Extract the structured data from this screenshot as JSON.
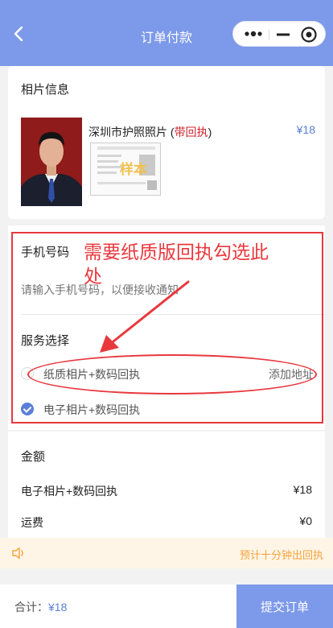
{
  "header": {
    "title": "订单付款",
    "back_icon": "chevron-left-icon",
    "capsule_icons": [
      "more-dots-icon",
      "minimize-icon",
      "close-circle-icon"
    ]
  },
  "photo_info": {
    "title": "相片信息",
    "product_name": "深圳市护照照片 (",
    "product_tag": "带回执",
    "product_tag_close": ")",
    "price": "¥18",
    "thumb_stamp": "样本"
  },
  "form": {
    "phone_label": "手机号码",
    "phone_placeholder": "请输入手机号码，以便接收通知",
    "service_label": "服务选择",
    "options": [
      {
        "label": "纸质相片+数码回执",
        "action": "添加地址",
        "checked": false
      },
      {
        "label": "电子相片+数码回执",
        "action": "",
        "checked": true
      }
    ]
  },
  "annotation": {
    "text": "需要纸质版回执勾选此处"
  },
  "amount": {
    "title": "金额",
    "rows": [
      {
        "label": "电子相片+数码回执",
        "value": "¥18"
      },
      {
        "label": "运费",
        "value": "¥0"
      }
    ]
  },
  "notice": {
    "text": "预计十分钟出回执",
    "icon": "speaker-icon"
  },
  "footer": {
    "total_label": "合计：",
    "total_value": "¥18",
    "submit_label": "提交订单"
  },
  "colors": {
    "brand": "#7d99e9",
    "accent_blue": "#5b7fd6",
    "annotation_red": "#e8383d",
    "notice_orange": "#f5a23c"
  }
}
